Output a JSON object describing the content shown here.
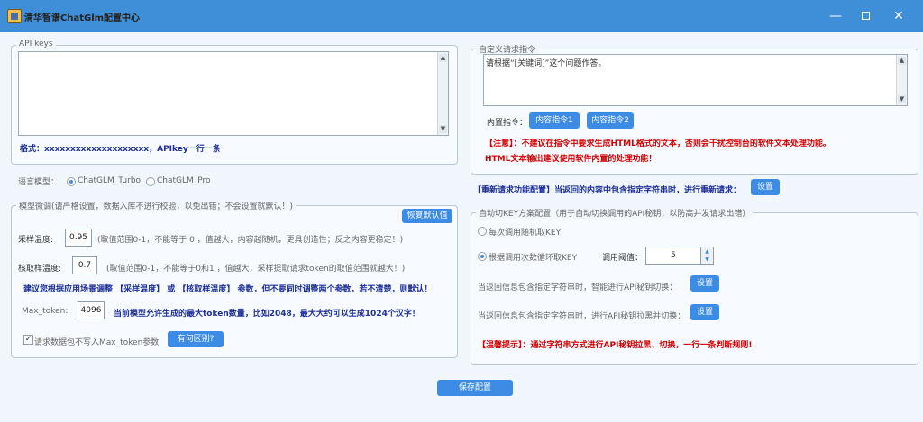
{
  "window": {
    "title": "清华智谱ChatGlm配置中心",
    "minimize_glyph": "—",
    "close_glyph": "✕"
  },
  "api_keys": {
    "legend": "API keys",
    "value": "",
    "format_hint": "格式：xxxxxxxxxxxxxxxxxxxx，APIkey一行一条"
  },
  "model": {
    "label": "语言模型：",
    "options": [
      "ChatGLM_Turbo",
      "ChatGLM_Pro"
    ],
    "selected": "ChatGLM_Turbo"
  },
  "tuning": {
    "legend": "模型微调(请严格设置，数据入库不进行校验，以免出错；不会设置就默认！)",
    "reset_label": "恢复默认值",
    "temperature_label": "采样温度:",
    "temperature_value": "0.95",
    "temperature_hint": "(取值范围0-1，不能等于 0 ，值越大，内容越随机，更具创造性；反之内容更稳定！)",
    "top_p_label": "核取样温度:",
    "top_p_value": "0.7",
    "top_p_hint": "(取值范围0-1，不能等于0和1 ，值越大，采样提取请求token的取值范围就越大！)",
    "advice": "建议您根据应用场景调整 【采样温度】 或 【核取样温度】 参数，但不要同时调整两个参数，若不清楚，则默认！",
    "max_token_label": "Max_token:",
    "max_token_value": "4096",
    "max_token_hint": "当前模型允许生成的最大token数量，比如2048，最大大约可以生成1024个汉字！",
    "checkbox_label": "请求数据包不写入Max_token参数",
    "checkbox_checked": true,
    "diff_button": "有何区别?"
  },
  "custom_prompt": {
    "legend": "自定义请求指令",
    "value": "请根据“[关键词]”这个问题作答。",
    "builtin_label": "内置指令：",
    "builtin_buttons": [
      "内容指令1",
      "内容指令2"
    ],
    "note1": "【注意】：不建议在指令中要求生成HTML格式的文本，否则会干扰控制台的软件文本处理功能。",
    "note2": "HTML文本输出建议使用软件内置的处理功能！"
  },
  "retry": {
    "text": "【重新请求功能配置】当返回的内容中包含指定字符串时，进行重新请求：",
    "button": "设置"
  },
  "key_switch": {
    "legend": "自动切KEY方案配置（用于自动切换调用的API秘钥，以防高并发请求出错）",
    "option_random": "每次调用随机取KEY",
    "option_cycle": "根据调用次数循环取KEY",
    "selected": "option_cycle",
    "threshold_label": "调用阈值：",
    "threshold_value": "5",
    "switch_text": "当返回信息包含指定字符串时，智能进行API秘钥切换：",
    "switch_button": "设置",
    "blacklist_text": "当返回信息包含指定字符串时，进行API秘钥拉黑并切换：",
    "blacklist_button": "设置",
    "tip": "【温馨提示】：通过字符串方式进行API秘钥拉黑、切换，一行一条判断规则!"
  },
  "save_button": "保存配置",
  "colors": {
    "titlebar": "#3f8ed8",
    "button": "#3c8be4",
    "warning": "#d40000",
    "emphasis": "#1e2f9a"
  }
}
